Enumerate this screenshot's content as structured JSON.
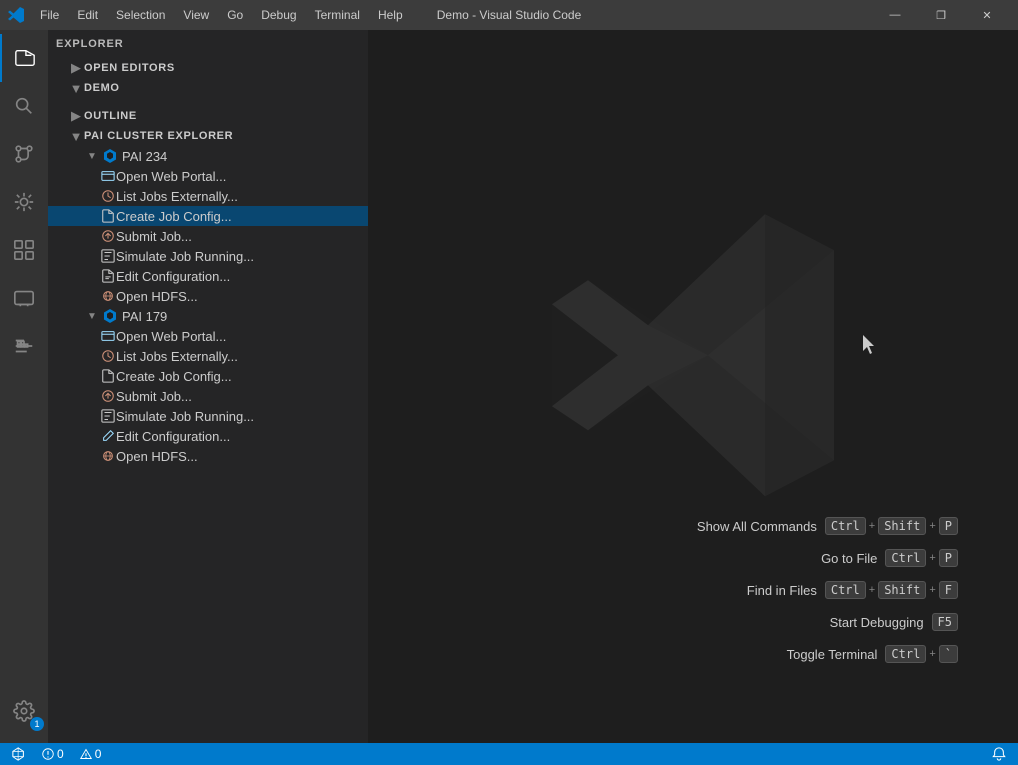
{
  "titleBar": {
    "title": "Demo - Visual Studio Code",
    "minimize": "—",
    "maximize": "❐",
    "close": "✕"
  },
  "menuBar": {
    "items": [
      "File",
      "Edit",
      "Selection",
      "View",
      "Go",
      "Debug",
      "Terminal",
      "Help"
    ]
  },
  "sidebar": {
    "explorerLabel": "EXPLORER",
    "openEditors": "OPEN EDITORS",
    "demo": "DEMO",
    "outline": "OUTLINE",
    "paiClusterExplorer": "PAI CLUSTER EXPLORER",
    "pai234": {
      "name": "PAI 234",
      "items": [
        "Open Web Portal...",
        "List Jobs Externally...",
        "Create Job Config...",
        "Submit Job...",
        "Simulate Job Running...",
        "Edit Configuration...",
        "Open HDFS..."
      ]
    },
    "pai179": {
      "name": "PAI 179",
      "items": [
        "Open Web Portal...",
        "List Jobs Externally...",
        "Create Job Config...",
        "Submit Job...",
        "Simulate Job Running...",
        "Edit Configuration...",
        "Open HDFS..."
      ]
    }
  },
  "shortcuts": [
    {
      "label": "Show All Commands",
      "keys": [
        "Ctrl",
        "+",
        "Shift",
        "+",
        "P"
      ]
    },
    {
      "label": "Go to File",
      "keys": [
        "Ctrl",
        "+",
        "P"
      ]
    },
    {
      "label": "Find in Files",
      "keys": [
        "Ctrl",
        "+",
        "Shift",
        "+",
        "F"
      ]
    },
    {
      "label": "Start Debugging",
      "keys": [
        "F5"
      ]
    },
    {
      "label": "Toggle Terminal",
      "keys": [
        "Ctrl",
        "+",
        "`"
      ]
    }
  ],
  "statusBar": {
    "left": [
      "⓪",
      "0",
      "⚠",
      "0"
    ],
    "rightItems": [
      "🔔"
    ]
  },
  "icons": {
    "explorer": "📄",
    "search": "🔍",
    "git": "⎇",
    "debug": "🐛",
    "extensions": "⊞",
    "remote": "🖥",
    "docker": "🐳",
    "settings": "⚙"
  }
}
